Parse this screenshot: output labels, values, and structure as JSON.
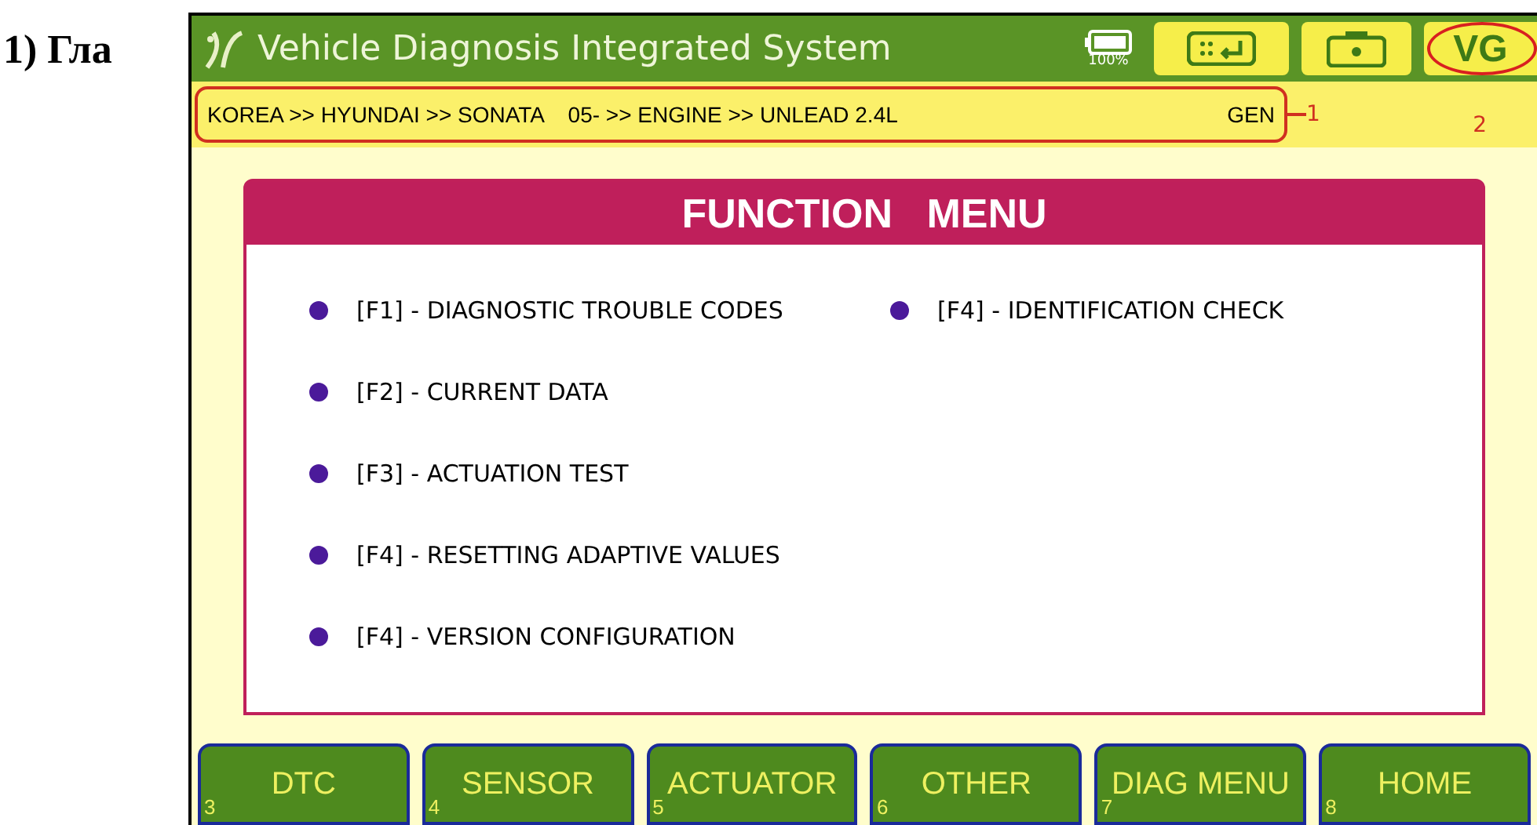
{
  "document_heading": "1) Гла",
  "title_bar": {
    "title": "Vehicle Diagnosis Integrated System",
    "battery": "100%",
    "vg_button": "VG"
  },
  "breadcrumb": {
    "path": "KOREA >> HYUNDAI >> SONATA    05- >> ENGINE >> UNLEAD 2.4L",
    "tag": "GEN"
  },
  "annotations": [
    "1",
    "2"
  ],
  "function_menu": {
    "title": "FUNCTION   MENU",
    "left_column": [
      "[F1] - DIAGNOSTIC TROUBLE CODES",
      "[F2] - CURRENT DATA",
      "[F3] - ACTUATION TEST",
      "[F4] - RESETTING ADAPTIVE VALUES",
      "[F4] - VERSION CONFIGURATION"
    ],
    "right_column": [
      "[F4] - IDENTIFICATION CHECK"
    ]
  },
  "bottom_buttons": [
    {
      "label": "DTC",
      "number": "3"
    },
    {
      "label": "SENSOR",
      "number": "4"
    },
    {
      "label": "ACTUATOR",
      "number": "5"
    },
    {
      "label": "OTHER",
      "number": "6"
    },
    {
      "label": "DIAG MENU",
      "number": "7"
    },
    {
      "label": "HOME",
      "number": "8"
    }
  ]
}
